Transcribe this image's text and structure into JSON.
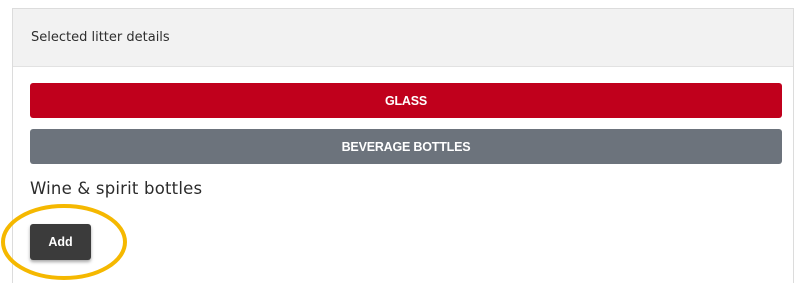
{
  "panel": {
    "header_title": "Selected litter details"
  },
  "categories": [
    {
      "label": "GLASS",
      "color": "#c0001c"
    },
    {
      "label": "BEVERAGE BOTTLES",
      "color": "#6c737c"
    }
  ],
  "selected_item": {
    "name": "Wine & spirit bottles"
  },
  "actions": {
    "add_label": "Add"
  },
  "annotation": {
    "ring_color": "#f5b800"
  }
}
